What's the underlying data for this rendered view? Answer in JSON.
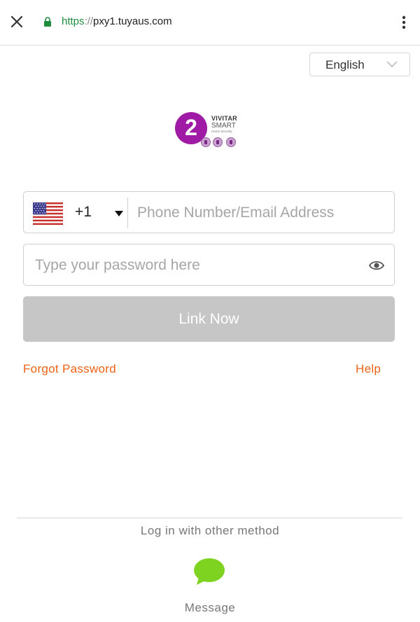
{
  "browser": {
    "url_scheme": "https",
    "url_separator": "://",
    "url_host": "pxy1.tuyaus.com",
    "close_icon": "close-icon",
    "lock_icon": "lock-icon",
    "menu_icon": "kebab-menu-icon"
  },
  "language_selector": {
    "value": "English",
    "icon": "chevron-down-icon"
  },
  "logo": {
    "number": "2",
    "brand_line1": "VIVITAR",
    "brand_line2": "SMART",
    "brand_line3": "Home Security",
    "accent_color": "#a01ba5"
  },
  "login_form": {
    "country_flag": "us-flag-icon",
    "country_code": "+1",
    "phone_placeholder": "Phone Number/Email Address",
    "password_placeholder": "Type your password here",
    "password_toggle_icon": "eye-icon",
    "submit_label": "Link Now",
    "submit_color": "#c6c6c6"
  },
  "links": {
    "forgot_password": "Forgot Password",
    "help": "Help",
    "link_color": "#ef6215"
  },
  "other_methods": {
    "heading": "Log in with other method",
    "message_label": "Message",
    "message_icon": "chat-bubble-icon",
    "message_color": "#7ed321"
  }
}
